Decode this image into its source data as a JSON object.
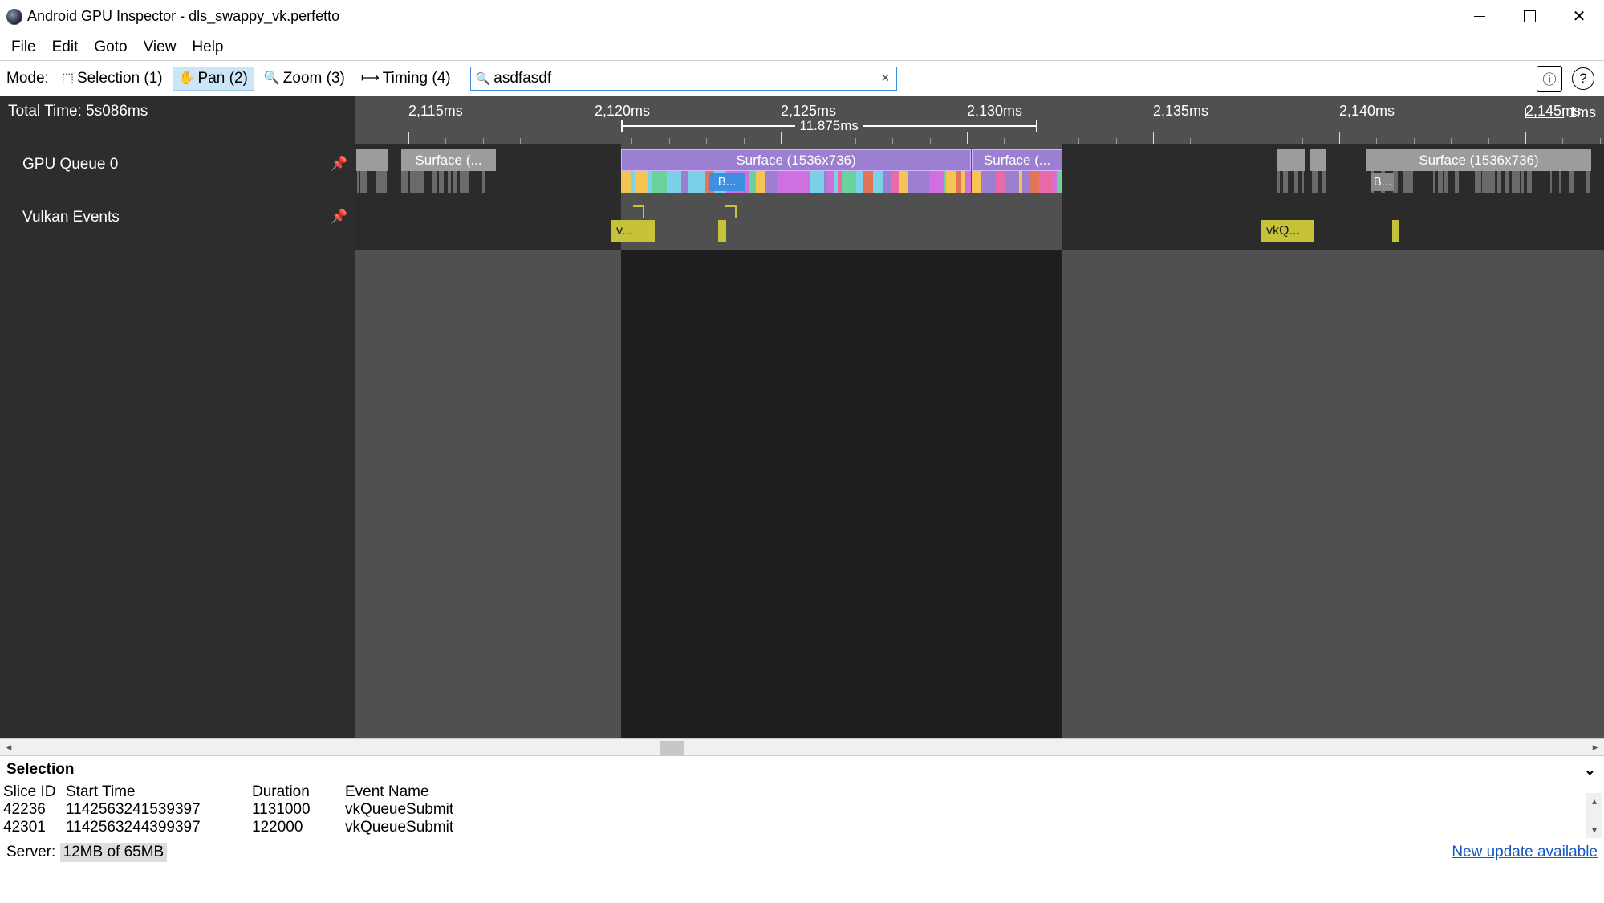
{
  "window": {
    "title": "Android GPU Inspector - dls_swappy_vk.perfetto"
  },
  "menu": {
    "items": [
      "File",
      "Edit",
      "Goto",
      "View",
      "Help"
    ]
  },
  "toolbar": {
    "mode_label": "Mode:",
    "selection": "Selection (1)",
    "pan": "Pan (2)",
    "zoom": "Zoom (3)",
    "timing": "Timing (4)",
    "search_value": "asdfasdf"
  },
  "ruler": {
    "total_time": "Total Time: 5s086ms",
    "scale": "1ms",
    "range_label": "11.875ms",
    "ticks": [
      "2,115ms",
      "2,120ms",
      "2,125ms",
      "2,130ms",
      "2,135ms",
      "2,140ms",
      "2,145ms"
    ]
  },
  "tracks": {
    "gpu_queue": {
      "label": "GPU Queue 0",
      "surface_far_left": "Surface (...",
      "surface_main": "Surface (1536x736)",
      "surface_main_sub": "B...",
      "surface_right": "Surface (...",
      "surface_far_right": "Surface (1536x736)",
      "surface_far_right_sub": "B..."
    },
    "vulkan": {
      "label": "Vulkan Events",
      "ev1": "v...",
      "ev3": "vkQ..."
    }
  },
  "selection_panel": {
    "title": "Selection",
    "headers": [
      "Slice ID",
      "Start Time",
      "Duration",
      "Event Name"
    ],
    "rows": [
      [
        "42236",
        "1142563241539397",
        "1131000",
        "vkQueueSubmit"
      ],
      [
        "42301",
        "1142563244399397",
        "122000",
        "vkQueueSubmit"
      ]
    ]
  },
  "status": {
    "server_label": "Server:",
    "mem": "12MB of 65MB",
    "update": "New update available"
  }
}
